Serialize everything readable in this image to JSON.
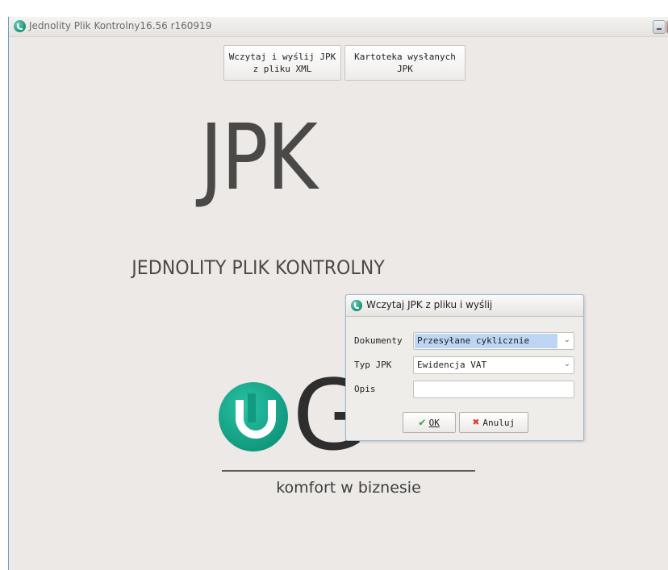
{
  "window": {
    "title": "Jednolity Plik Kontrolny16.56 r160919"
  },
  "toolbar": {
    "load_send_line1": "Wczytaj i wyślij JPK",
    "load_send_line2": "z pliku XML",
    "history_line1": "Kartoteka wysłanych",
    "history_line2": "JPK"
  },
  "banner": {
    "big_title": "JPK",
    "subtitle": "JEDNOLITY PLIK KONTROLNY"
  },
  "logo": {
    "letter_g": "G",
    "tagline": "komfort w biznesie"
  },
  "dialog": {
    "title": "Wczytaj JPK z pliku i wyślij",
    "documents_label": "Dokumenty",
    "documents_value": "Przesyłane cyklicznie",
    "type_label": "Typ JPK",
    "type_value": "Ewidencja VAT",
    "desc_label": "Opis",
    "desc_value": "",
    "ok_label": "OK",
    "cancel_label": "Anuluj"
  },
  "icons": {
    "app": "app-logo-icon",
    "ok": "check-icon",
    "cancel": "x-icon",
    "dropdown": "chevron-down-icon"
  },
  "colors": {
    "accent_teal": "#119a80",
    "highlight": "#bcd6f4",
    "background": "#ece9e6"
  }
}
